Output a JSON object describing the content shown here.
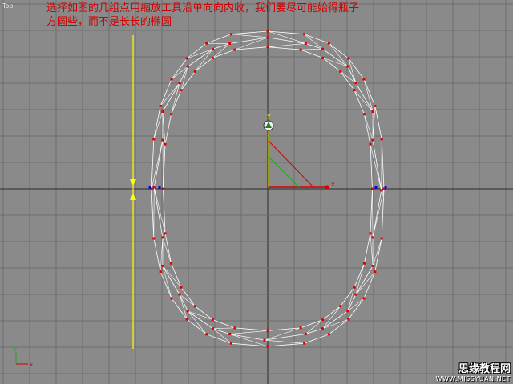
{
  "viewport": {
    "label": "Top",
    "background": "#8a8a8a",
    "grid_color": "#6e6e6e",
    "axis_color": "#2b2b2b"
  },
  "instruction": {
    "text": "选择如图的几组点用缩放工具沿单向向内收，我们要尽可能始得瓶子\n方圆些，而不是长长的椭圆",
    "color": "#d10000"
  },
  "gizmo": {
    "x_axis_label": "x",
    "y_axis_label": "y",
    "x_color": "#d40000",
    "y_color": "#e0e000",
    "plane_color": "#2da02d"
  },
  "corner_axis": {
    "x_label": "x",
    "y_label": "y"
  },
  "watermark": {
    "main": "思缘教程网",
    "sub": "WWW.MISSYUAN.NET"
  },
  "mesh": {
    "wire_color": "#ffffff",
    "vertex_color": "#e00000",
    "selected_vertex_color": "#0000ff",
    "guide_line_color": "#ffff00"
  }
}
